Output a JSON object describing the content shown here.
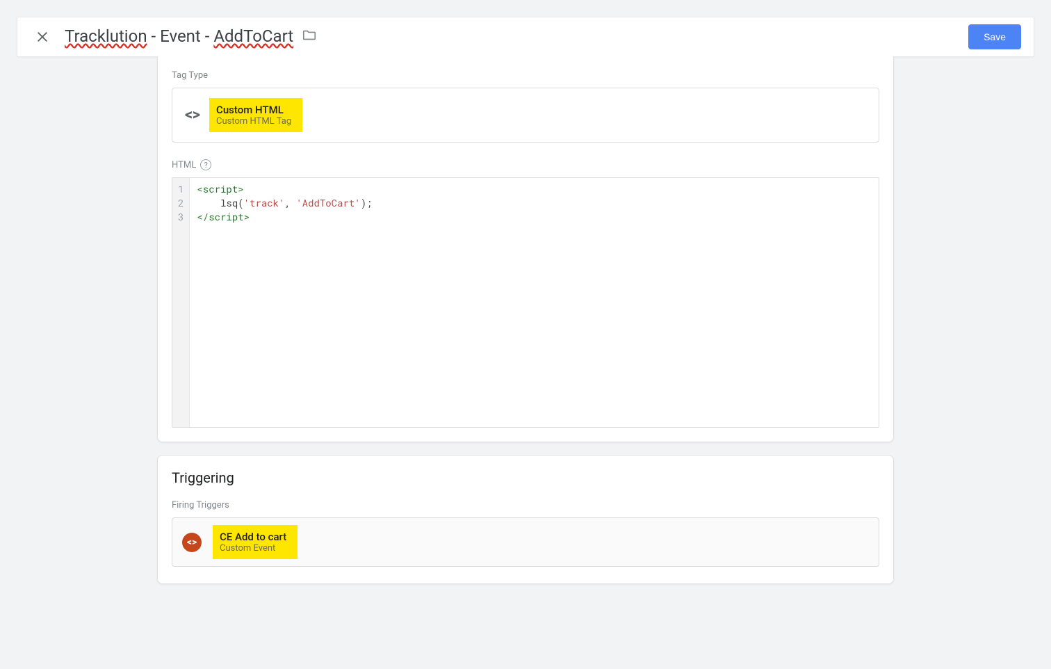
{
  "header": {
    "tag_name_pre": "Tracklution",
    "tag_name_mid": " - Event - ",
    "tag_name_post": "AddToCart",
    "save_label": "Save"
  },
  "tag_config": {
    "type_label": "Tag Type",
    "type_title": "Custom HTML",
    "type_subtitle": "Custom HTML Tag",
    "html_label": "HTML",
    "code": {
      "gutter": [
        "1",
        "2",
        "3"
      ],
      "line1_open": "<script>",
      "line2_fn": "lsq",
      "line2_args_open": "(",
      "line2_arg1": "'track'",
      "line2_comma": ", ",
      "line2_arg2": "'AddToCart'",
      "line2_close": ");",
      "line3_close": "</scr"
    }
  },
  "triggering": {
    "title": "Triggering",
    "firing_label": "Firing Triggers",
    "trigger_title": "CE Add to cart",
    "trigger_subtitle": "Custom Event"
  }
}
